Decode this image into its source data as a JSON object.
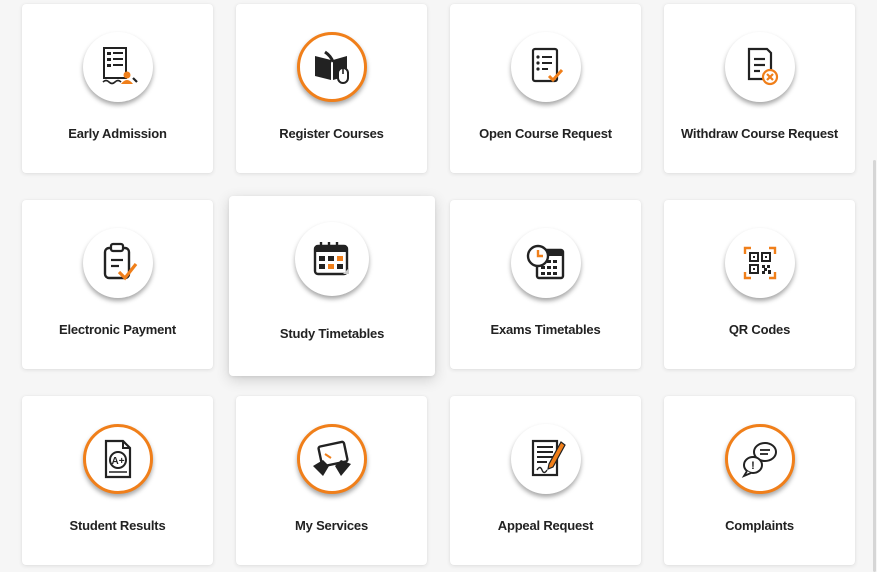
{
  "colors": {
    "accent": "#f07f1a",
    "ink": "#222222",
    "card": "#ffffff",
    "background": "#f6f6f6"
  },
  "services": [
    {
      "label": "Early Admission",
      "icon": "admission-form-icon"
    },
    {
      "label": "Register Courses",
      "icon": "book-mouse-icon"
    },
    {
      "label": "Open Course Request",
      "icon": "checklist-icon"
    },
    {
      "label": "Withdraw Course Request",
      "icon": "document-cancel-icon"
    },
    {
      "label": "Electronic Payment",
      "icon": "clipboard-check-icon"
    },
    {
      "label": "Study Timetables",
      "icon": "calendar-icon"
    },
    {
      "label": "Exams Timetables",
      "icon": "clock-calendar-icon"
    },
    {
      "label": "QR Codes",
      "icon": "qr-code-icon"
    },
    {
      "label": "Student Results",
      "icon": "grade-certificate-icon"
    },
    {
      "label": "My Services",
      "icon": "tablet-hands-icon"
    },
    {
      "label": "Appeal Request",
      "icon": "signed-document-icon"
    },
    {
      "label": "Complaints",
      "icon": "chat-bubbles-icon"
    }
  ]
}
